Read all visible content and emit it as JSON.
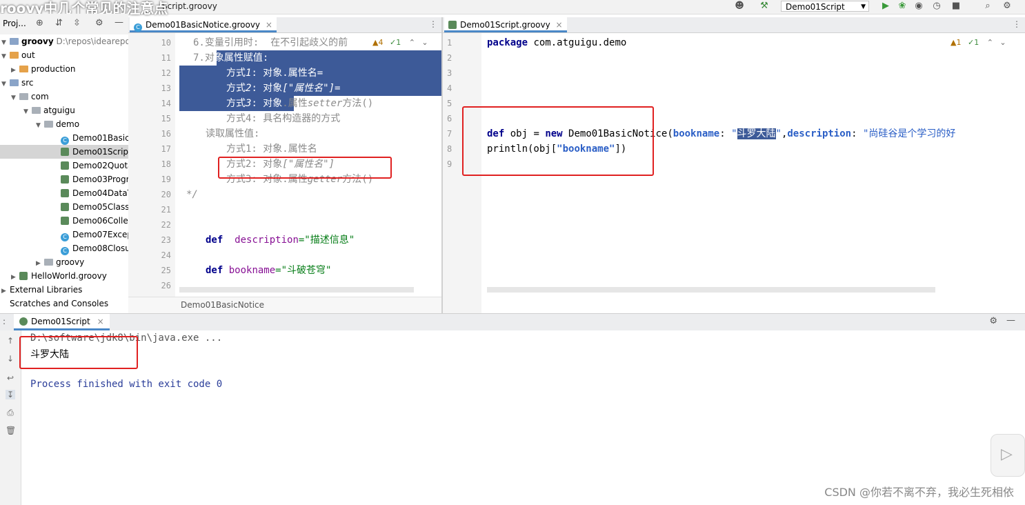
{
  "video_title": "roovy中几个常见的注意点",
  "toolbar": {
    "breadcrumb_start": "roovy",
    "breadcrumb_file": "Script.groovy",
    "run_config": "Demo01Script"
  },
  "project_panel": {
    "title": "Proj...",
    "items": [
      {
        "label": "groovy",
        "extra": "D:\\repos\\idearepos\\g",
        "kind": "root"
      },
      {
        "label": "out",
        "kind": "folder-orange"
      },
      {
        "label": "production",
        "kind": "folder-orange"
      },
      {
        "label": "src",
        "kind": "folder-blue"
      },
      {
        "label": "com",
        "kind": "folder-grey"
      },
      {
        "label": "atguigu",
        "kind": "folder-grey"
      },
      {
        "label": "demo",
        "kind": "folder-grey"
      },
      {
        "label": "Demo01Basic",
        "kind": "class"
      },
      {
        "label": "Demo01Script",
        "kind": "groovy"
      },
      {
        "label": "Demo02Quota",
        "kind": "groovy"
      },
      {
        "label": "Demo03Progr",
        "kind": "groovy"
      },
      {
        "label": "Demo04DataT",
        "kind": "groovy"
      },
      {
        "label": "Demo05ClassI",
        "kind": "groovy"
      },
      {
        "label": "Demo06Collec",
        "kind": "groovy"
      },
      {
        "label": "Demo07Excep",
        "kind": "class"
      },
      {
        "label": "Demo08Closu",
        "kind": "class"
      },
      {
        "label": "groovy",
        "kind": "folder-grey"
      },
      {
        "label": "HelloWorld.groovy",
        "kind": "groovy"
      },
      {
        "label": "External Libraries",
        "kind": "lib"
      },
      {
        "label": "Scratches and Consoles",
        "kind": "scratch"
      }
    ]
  },
  "left_editor": {
    "tab": "Demo01BasicNotice.groovy",
    "inspection": {
      "warnings": "4",
      "weak": "1"
    },
    "footer_breadcrumb": "Demo01BasicNotice",
    "line_numbers": [
      "10",
      "11",
      "12",
      "13",
      "14",
      "15",
      "16",
      "17",
      "18",
      "19",
      "20",
      "21",
      "22",
      "23",
      "24",
      "25",
      "26"
    ],
    "lines": {
      "l10": "6.变量引用时:  在不引起歧义的前",
      "l11_a": "7.对",
      "l11_b": "象属性赋值:",
      "l12_a": "方式",
      "l12_b": "1",
      "l12_c": ": 对象.属性名=",
      "l13_a": "方式",
      "l13_b": "2",
      "l13_c": ": 对象",
      "l13_d": "[\"属性名\"]=",
      "l14_a": "方式",
      "l14_b": "3",
      "l14_c": ": 对象",
      "l14_d": ".属性",
      "l14_e": "setter",
      "l14_f": "方法()",
      "l15": "方式4: 具名构造器的方式",
      "l16": "读取属性值:",
      "l17": "方式1: 对象.属性名",
      "l18_a": "方式2: 对象",
      "l18_b": "[\"属性名\"]",
      "l19_a": "方式3: 对象.属性",
      "l19_b": "getter",
      "l19_c": "方法()",
      "l20": "*/",
      "l23_kw": "def",
      "l23_var": "description",
      "l23_str": "=\"描述信息\"",
      "l25_kw": "def",
      "l25_var": "bookname",
      "l25_str": "=\"斗破苍穹\""
    }
  },
  "right_editor": {
    "tab": "Demo01Script.groovy",
    "inspection": {
      "warnings": "1",
      "weak": "1"
    },
    "line_numbers": [
      "1",
      "2",
      "3",
      "4",
      "5",
      "6",
      "7",
      "8",
      "9"
    ],
    "lines": {
      "l1_kw": "package",
      "l1_rest": " com.atguigu.demo",
      "l7_kw1": "def",
      "l7_a": " obj = ",
      "l7_kw2": "new",
      "l7_b": " Demo01BasicNotice(",
      "l7_p1": "bookname",
      "l7_c": ": ",
      "l7_q1": "\"",
      "l7_s1": "斗罗大陆",
      "l7_q2": "\"",
      "l7_d": ",",
      "l7_p2": "description",
      "l7_e": ": ",
      "l7_s2": "\"尚硅谷是个学习的好",
      "l8_a": "println(obj[",
      "l8_s": "\"bookname\"",
      "l8_b": "])"
    }
  },
  "run_panel": {
    "label": "Demo01Script",
    "output": [
      "D:\\software\\jdk8\\bin\\java.exe ...",
      "斗罗大陆",
      "Process finished with exit code 0"
    ]
  },
  "watermark": "CSDN @你若不离不弃，我必生死相依",
  "colors": {
    "selection": "#3d5a98",
    "annotation_box": "#e02020",
    "keyword": "#00008b"
  }
}
